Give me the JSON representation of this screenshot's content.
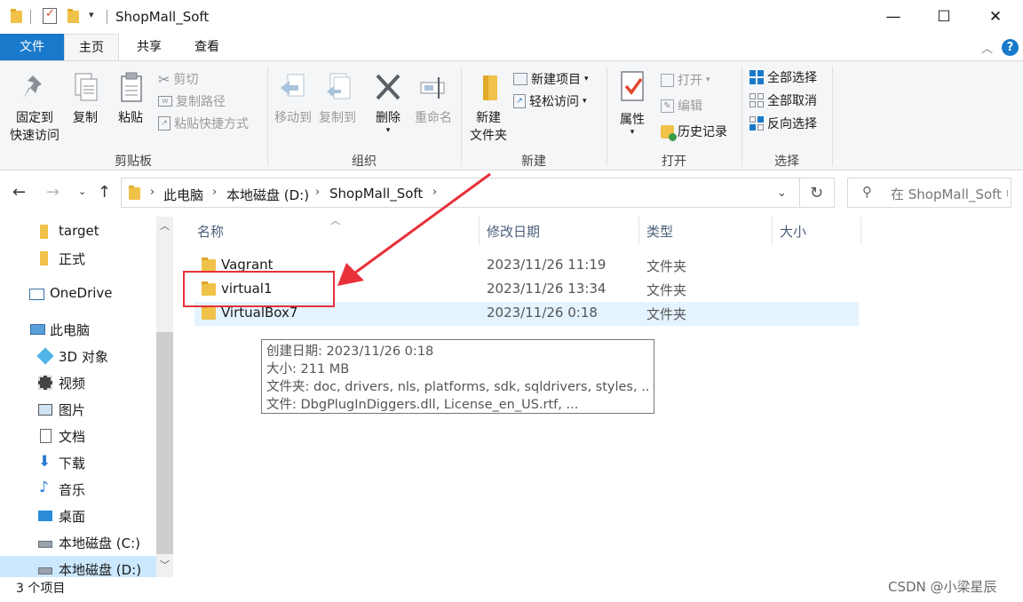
{
  "window": {
    "title": "ShopMall_Soft",
    "minimize": "—",
    "maximize": "☐",
    "close": "✕"
  },
  "ribbon_tabs": [
    "文件",
    "主页",
    "共享",
    "查看"
  ],
  "ribbon": {
    "clipboard": {
      "pin_line1": "固定到",
      "pin_line2": "快速访问",
      "copy": "复制",
      "paste": "粘贴",
      "cut": "剪切",
      "copy_path": "复制路径",
      "paste_shortcut": "粘贴快捷方式",
      "label": "剪贴板"
    },
    "organize": {
      "move_to": "移动到",
      "copy_to": "复制到",
      "delete": "删除",
      "rename": "重命名",
      "label": "组织"
    },
    "new": {
      "new_folder_line1": "新建",
      "new_folder_line2": "文件夹",
      "new_item": "新建项目",
      "easy_access": "轻松访问",
      "label": "新建"
    },
    "open": {
      "properties": "属性",
      "open": "打开",
      "edit": "编辑",
      "history": "历史记录",
      "label": "打开"
    },
    "select": {
      "select_all": "全部选择",
      "select_none": "全部取消",
      "invert": "反向选择",
      "label": "选择"
    }
  },
  "address": {
    "crumbs": [
      "此电脑",
      "本地磁盘 (D:)",
      "ShopMall_Soft"
    ],
    "search_placeholder": "在 ShopMall_Soft 中搜索"
  },
  "nav_pane": [
    {
      "label": "target",
      "icon": "folder-icon"
    },
    {
      "label": "正式",
      "icon": "folder-icon"
    },
    {
      "label": "OneDrive",
      "icon": "cloud-icon"
    },
    {
      "label": "此电脑",
      "icon": "computer-icon"
    },
    {
      "label": "3D 对象",
      "icon": "cube-icon"
    },
    {
      "label": "视频",
      "icon": "video-icon"
    },
    {
      "label": "图片",
      "icon": "picture-icon"
    },
    {
      "label": "文档",
      "icon": "document-icon"
    },
    {
      "label": "下载",
      "icon": "download-icon"
    },
    {
      "label": "音乐",
      "icon": "music-icon"
    },
    {
      "label": "桌面",
      "icon": "desktop-icon"
    },
    {
      "label": "本地磁盘 (C:)",
      "icon": "drive-icon"
    },
    {
      "label": "本地磁盘 (D:)",
      "icon": "drive-icon"
    }
  ],
  "columns": [
    "名称",
    "修改日期",
    "类型",
    "大小"
  ],
  "files": [
    {
      "name": "Vagrant",
      "modified": "2023/11/26 11:19",
      "type": "文件夹"
    },
    {
      "name": "virtual1",
      "modified": "2023/11/26 13:34",
      "type": "文件夹"
    },
    {
      "name": "VirtualBox7",
      "modified": "2023/11/26 0:18",
      "type": "文件夹"
    }
  ],
  "tooltip": {
    "line1": "创建日期: 2023/11/26 0:18",
    "line2": "大小: 211 MB",
    "line3": "文件夹: doc, drivers, nls, platforms, sdk, sqldrivers, styles, ...",
    "line4": "文件: DbgPlugInDiggers.dll, License_en_US.rtf, ..."
  },
  "status": "3 个项目",
  "watermark": "CSDN @小梁星辰",
  "colors": {
    "accent": "#1979ca",
    "annotation": "#e8303a",
    "selection": "#e5f3ff"
  }
}
